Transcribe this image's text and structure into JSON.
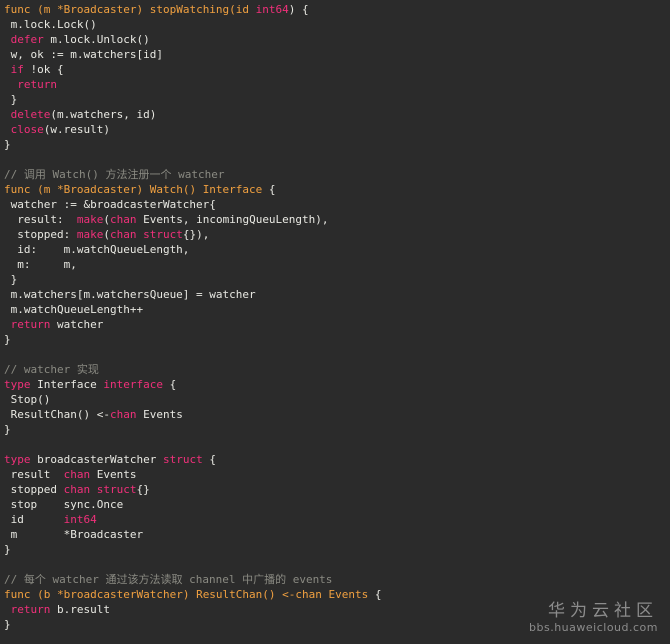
{
  "code": {
    "lines": [
      [
        {
          "t": "func ",
          "c": "fn"
        },
        {
          "t": "(m *Broadcaster) stopWatching(id ",
          "c": "fn"
        },
        {
          "t": "int64",
          "c": "kw"
        },
        {
          "t": ") {"
        }
      ],
      [
        {
          "t": " m.lock.Lock()"
        }
      ],
      [
        {
          "t": " "
        },
        {
          "t": "defer",
          "c": "kw"
        },
        {
          "t": " m.lock.Unlock()"
        }
      ],
      [
        {
          "t": " w, ok := m.watchers[id]"
        }
      ],
      [
        {
          "t": " "
        },
        {
          "t": "if",
          "c": "kw"
        },
        {
          "t": " !ok {"
        }
      ],
      [
        {
          "t": "  "
        },
        {
          "t": "return",
          "c": "kw"
        }
      ],
      [
        {
          "t": " }"
        }
      ],
      [
        {
          "t": " "
        },
        {
          "t": "delete",
          "c": "kw"
        },
        {
          "t": "(m.watchers, id)"
        }
      ],
      [
        {
          "t": " "
        },
        {
          "t": "close",
          "c": "kw"
        },
        {
          "t": "(w.result)"
        }
      ],
      [
        {
          "t": "}"
        }
      ],
      [],
      [
        {
          "t": "// 调用 Watch() 方法注册一个 watcher",
          "c": "cm"
        }
      ],
      [
        {
          "t": "func ",
          "c": "fn"
        },
        {
          "t": "(m *Broadcaster) Watch() Interface",
          "c": "fn"
        },
        {
          "t": " {"
        }
      ],
      [
        {
          "t": " watcher := &broadcasterWatcher{"
        }
      ],
      [
        {
          "t": "  result:  "
        },
        {
          "t": "make",
          "c": "kw"
        },
        {
          "t": "("
        },
        {
          "t": "chan",
          "c": "kw"
        },
        {
          "t": " Events, incomingQueuLength),"
        }
      ],
      [
        {
          "t": "  stopped: "
        },
        {
          "t": "make",
          "c": "kw"
        },
        {
          "t": "("
        },
        {
          "t": "chan",
          "c": "kw"
        },
        {
          "t": " "
        },
        {
          "t": "struct",
          "c": "kw"
        },
        {
          "t": "{}),"
        }
      ],
      [
        {
          "t": "  id:    m.watchQueueLength,"
        }
      ],
      [
        {
          "t": "  m:     m,"
        }
      ],
      [
        {
          "t": " }"
        }
      ],
      [
        {
          "t": " m.watchers[m.watchersQueue] = watcher"
        }
      ],
      [
        {
          "t": " m.watchQueueLength++"
        }
      ],
      [
        {
          "t": " "
        },
        {
          "t": "return",
          "c": "kw"
        },
        {
          "t": " watcher"
        }
      ],
      [
        {
          "t": "}"
        }
      ],
      [],
      [
        {
          "t": "// watcher 实现",
          "c": "cm"
        }
      ],
      [
        {
          "t": "type",
          "c": "kw"
        },
        {
          "t": " Interface "
        },
        {
          "t": "interface",
          "c": "kw"
        },
        {
          "t": " {"
        }
      ],
      [
        {
          "t": " Stop()"
        }
      ],
      [
        {
          "t": " ResultChan() <-"
        },
        {
          "t": "chan",
          "c": "kw"
        },
        {
          "t": " Events"
        }
      ],
      [
        {
          "t": "}"
        }
      ],
      [],
      [
        {
          "t": "type",
          "c": "kw"
        },
        {
          "t": " broadcasterWatcher "
        },
        {
          "t": "struct",
          "c": "kw"
        },
        {
          "t": " {"
        }
      ],
      [
        {
          "t": " result  "
        },
        {
          "t": "chan",
          "c": "kw"
        },
        {
          "t": " Events"
        }
      ],
      [
        {
          "t": " stopped "
        },
        {
          "t": "chan",
          "c": "kw"
        },
        {
          "t": " "
        },
        {
          "t": "struct",
          "c": "kw"
        },
        {
          "t": "{}"
        }
      ],
      [
        {
          "t": " stop    sync.Once"
        }
      ],
      [
        {
          "t": " id      "
        },
        {
          "t": "int64",
          "c": "kw"
        }
      ],
      [
        {
          "t": " m       *Broadcaster"
        }
      ],
      [
        {
          "t": "}"
        }
      ],
      [],
      [
        {
          "t": "// 每个 watcher 通过该方法读取 channel 中广播的 events",
          "c": "cm"
        }
      ],
      [
        {
          "t": "func ",
          "c": "fn"
        },
        {
          "t": "(b *broadcasterWatcher) ResultChan() <-chan Events",
          "c": "fn"
        },
        {
          "t": " {"
        }
      ],
      [
        {
          "t": " "
        },
        {
          "t": "return",
          "c": "kw"
        },
        {
          "t": " b.result"
        }
      ],
      [
        {
          "t": "}"
        }
      ]
    ]
  },
  "watermark": {
    "brand": "华为云社区",
    "url": "bbs.huaweicloud.com"
  }
}
